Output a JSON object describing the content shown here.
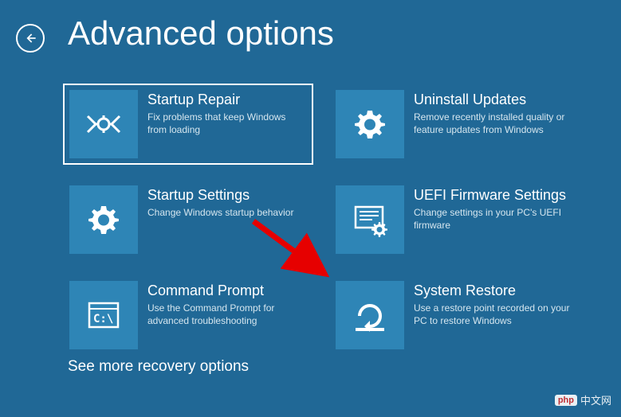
{
  "page_title": "Advanced options",
  "options": [
    {
      "title": "Startup Repair",
      "desc": "Fix problems that keep Windows from loading",
      "icon": "startup-repair-icon",
      "selected": true
    },
    {
      "title": "Uninstall Updates",
      "desc": "Remove recently installed quality or feature updates from Windows",
      "icon": "gear-icon",
      "selected": false
    },
    {
      "title": "Startup Settings",
      "desc": "Change Windows startup behavior",
      "icon": "gear-icon",
      "selected": false
    },
    {
      "title": "UEFI Firmware Settings",
      "desc": "Change settings in your PC's UEFI firmware",
      "icon": "uefi-icon",
      "selected": false
    },
    {
      "title": "Command Prompt",
      "desc": "Use the Command Prompt for advanced troubleshooting",
      "icon": "cmd-icon",
      "selected": false
    },
    {
      "title": "System Restore",
      "desc": "Use a restore point recorded on your PC to restore Windows",
      "icon": "restore-icon",
      "selected": false
    }
  ],
  "more_options_label": "See more recovery options",
  "watermark": {
    "badge": "php",
    "text": "中文网"
  },
  "colors": {
    "background": "#206896",
    "tile_icon_bg": "#2e85b6"
  }
}
